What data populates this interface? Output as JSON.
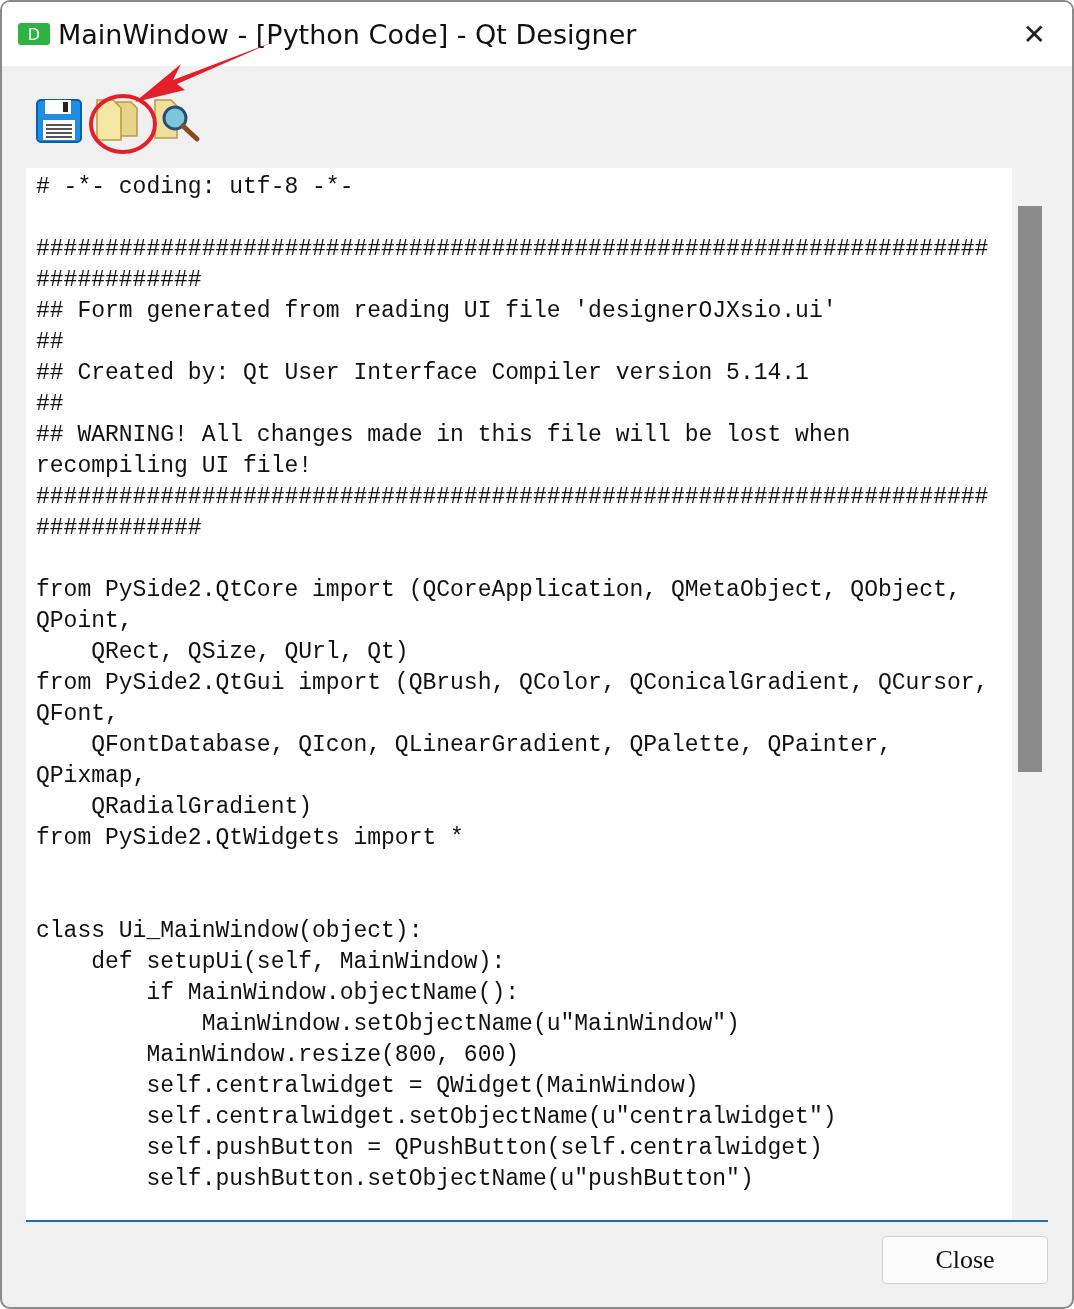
{
  "window": {
    "title": "MainWindow - [Python Code] - Qt Designer",
    "app_icon_letter": "D",
    "close_glyph": "✕"
  },
  "toolbar": [
    {
      "kind": "save"
    },
    {
      "kind": "copy"
    },
    {
      "kind": "find"
    }
  ],
  "annotation": {
    "kind": "arrow-circle"
  },
  "code_blocks": [
    {
      "kind": "top",
      "lines": [
        "# -*- coding: utf-8 -*-"
      ]
    },
    {
      "kind": "spaced",
      "lines": [
        "#####################################################################",
        "############",
        "## Form generated from reading UI file 'designerOJXsio.ui'",
        "##",
        "## Created by: Qt User Interface Compiler version 5.14.1",
        "##",
        "## WARNING! All changes made in this file will be lost when",
        "recompiling UI file!",
        "#####################################################################",
        "############"
      ]
    },
    {
      "kind": "spaced",
      "lines": [
        "from PySide2.QtCore import (QCoreApplication, QMetaObject, QObject,",
        "QPoint,",
        "    QRect, QSize, QUrl, Qt)",
        "from PySide2.QtGui import (QBrush, QColor, QConicalGradient, QCursor,",
        "QFont,",
        "    QFontDatabase, QIcon, QLinearGradient, QPalette, QPainter,",
        "QPixmap,",
        "    QRadialGradient)",
        "from PySide2.QtWidgets import *"
      ]
    },
    {
      "kind": "double-spaced",
      "lines": [
        "class Ui_MainWindow(object):",
        "    def setupUi(self, MainWindow):",
        "        if MainWindow.objectName():",
        "            MainWindow.setObjectName(u\"MainWindow\")",
        "        MainWindow.resize(800, 600)",
        "        self.centralwidget = QWidget(MainWindow)",
        "        self.centralwidget.setObjectName(u\"centralwidget\")",
        "        self.pushButton = QPushButton(self.centralwidget)",
        "        self.pushButton.setObjectName(u\"pushButton\")"
      ]
    }
  ],
  "close_button": "Close"
}
